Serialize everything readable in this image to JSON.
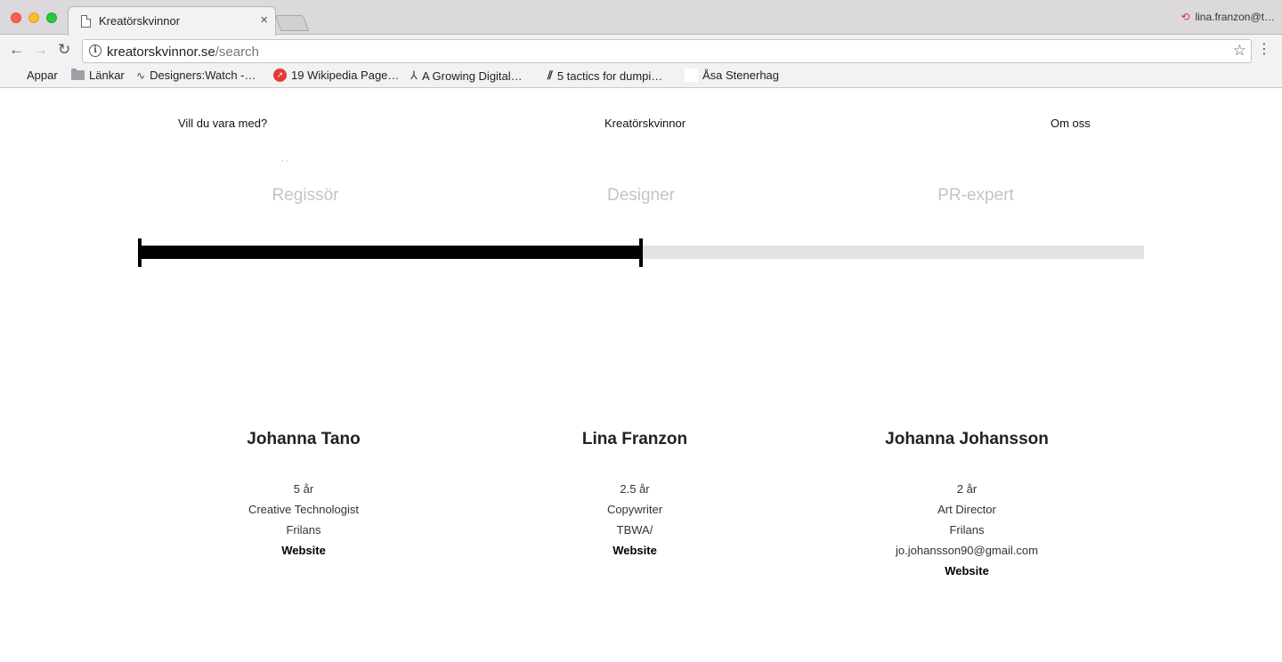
{
  "browser": {
    "tab_title": "Kreatörskvinnor",
    "tab_close": "×",
    "profile_name": "lina.franzon@t…",
    "url_host": "kreatorskvinnor.se",
    "url_path": "/search",
    "bookmarks": [
      {
        "label": "Appar",
        "icon": "apps-icon"
      },
      {
        "label": "Länkar",
        "icon": "folder-icon"
      },
      {
        "label": "Designers:Watch -…",
        "icon": "wave-icon"
      },
      {
        "label": "19 Wikipedia Page…",
        "icon": "wiki-icon"
      },
      {
        "label": "A Growing Digital…",
        "icon": "growing-icon"
      },
      {
        "label": "5 tactics for dumpi…",
        "icon": "tactics-icon"
      },
      {
        "label": "Åsa Stenerhag",
        "icon": "blank-icon"
      }
    ]
  },
  "nav": {
    "left": "Vill du vara med?",
    "center": "Kreatörskvinnor",
    "right": "Om oss"
  },
  "roles": {
    "faint_marks": "‚ ‚",
    "items": [
      "Regissör",
      "Designer",
      "PR-expert"
    ]
  },
  "slider": {
    "value_fraction": 0.5
  },
  "profiles": [
    {
      "name": "Johanna Tano",
      "experience": "5 år",
      "title": "Creative Technologist",
      "employer": "Frilans",
      "email": "",
      "website_label": "Website"
    },
    {
      "name": "Lina Franzon",
      "experience": "2.5 år",
      "title": "Copywriter",
      "employer": "TBWA/",
      "email": "",
      "website_label": "Website"
    },
    {
      "name": "Johanna Johansson",
      "experience": "2 år",
      "title": "Art Director",
      "employer": "Frilans",
      "email": "jo.johansson90@gmail.com",
      "website_label": "Website"
    }
  ]
}
